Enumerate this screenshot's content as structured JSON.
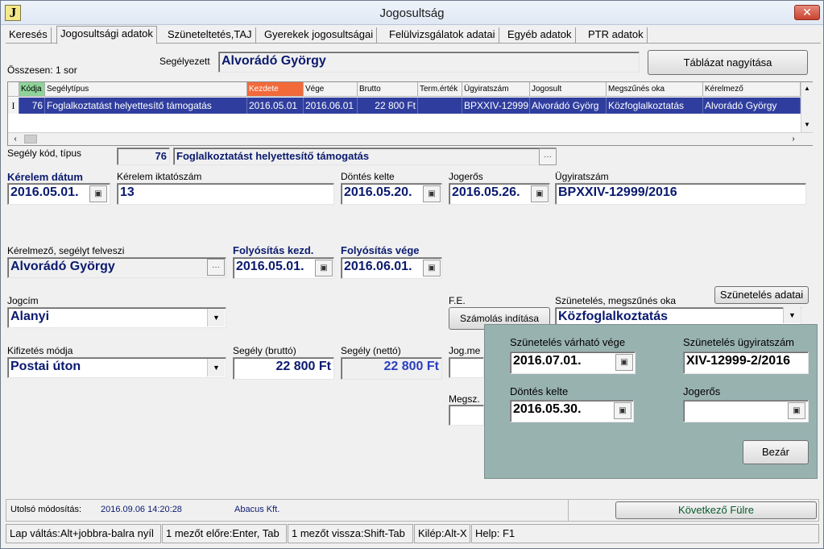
{
  "window": {
    "title": "Jogosultság",
    "icon_letter": "J",
    "close_label": "✕"
  },
  "tabs": [
    {
      "label": "Keresés"
    },
    {
      "label": "Jogosultsági adatok"
    },
    {
      "label": "Szüneteltetés,TAJ"
    },
    {
      "label": "Gyerekek jogosultságai"
    },
    {
      "label": "Felülvizsgálatok adatai"
    },
    {
      "label": "Egyéb adatok"
    },
    {
      "label": "PTR adatok"
    }
  ],
  "summary": {
    "count_label": "Összesen: 1 sor",
    "beneficiary_label": "Segélyezett",
    "beneficiary_name": "Alvorádó György",
    "enlarge_button": "Táblázat nagyítása"
  },
  "grid": {
    "headers": [
      "Kódja",
      "Segélytípus",
      "Kezdete",
      "Vége",
      "Brutto",
      "Term.érték",
      "Ügyiratszám",
      "Jogosult",
      "Megszűnés oka",
      "Kérelmező"
    ],
    "row": {
      "indicator": "I",
      "code": "76",
      "type": "Foglalkoztatást helyettesítő támogatás",
      "start": "2016.05.01",
      "end": "2016.06.01",
      "gross": "22 800 Ft",
      "term_value": "",
      "case_no": "BPXXIV-12999",
      "entitled": "Alvorádó Györg",
      "end_reason": "Közfoglalkoztatás",
      "applicant": "Alvorádó György"
    }
  },
  "form": {
    "aid_code_label": "Segély kód, típus",
    "aid_code": "76",
    "aid_type": "Foglalkoztatást helyettesítő támogatás",
    "request_date_label": "Kérelem dátum",
    "request_date": "2016.05.01.",
    "request_reg_label": "Kérelem iktatószám",
    "request_reg": "13",
    "decision_date_label": "Döntés kelte",
    "decision_date": "2016.05.20.",
    "final_label": "Jogerős",
    "final_date": "2016.05.26.",
    "case_no_label": "Ügyiratszám",
    "case_no": "BPXXIV-12999/2016",
    "applicant_label": "Kérelmező, segélyt felveszi",
    "applicant": "Alvorádó György",
    "pay_start_label": "Folyósítás kezd.",
    "pay_start": "2016.05.01.",
    "pay_end_label": "Folyósítás vége",
    "pay_end": "2016.06.01.",
    "title_label": "Jogcím",
    "title_value": "Alanyi",
    "fe_label": "F.E.",
    "calc_button": "Számolás indítása",
    "suspend_label": "Szünetelés, megszűnés oka",
    "suspend_data_button": "Szünetelés adatai",
    "suspend_value": "Közfoglalkoztatás",
    "payment_label": "Kifizetés módja",
    "payment_value": "Postai úton",
    "gross_label": "Segély (bruttó)",
    "gross_value": "22 800 Ft",
    "net_label": "Segély (nettó)",
    "net_value": "22 800 Ft",
    "jog_label": "Jog.me",
    "megsz_label": "Megsz."
  },
  "popup": {
    "expected_end_label": "Szünetelés várható vége",
    "expected_end": "2016.07.01.",
    "case_label": "Szünetelés ügyiratszám",
    "case_value": "XIV-12999-2/2016",
    "decision_label": "Döntés kelte",
    "decision_value": "2016.05.30.",
    "final_label": "Jogerős",
    "final_value": "",
    "close_button": "Bezár"
  },
  "footer": {
    "modified_label": "Utolsó módosítás:",
    "modified_at": "2016.09.06 14:20:28",
    "modified_by": "Abacus Kft.",
    "next_tab_button": "Következő Fülre"
  },
  "statusbar": [
    "Lap váltás:Alt+jobbra-balra nyíl",
    "1 mezőt előre:Enter, Tab",
    "1 mezőt vissza:Shift-Tab",
    "Kilép:Alt-X",
    "Help: F1"
  ]
}
